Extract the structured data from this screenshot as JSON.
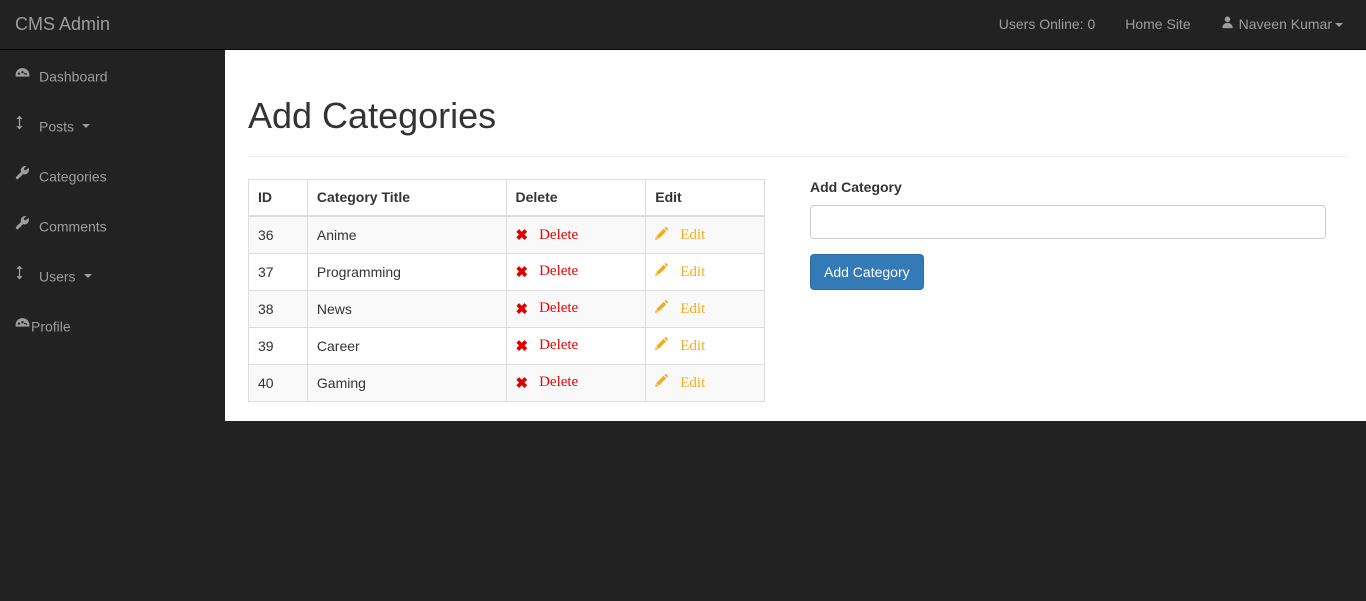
{
  "navbar": {
    "brand": "CMS Admin",
    "users_online": "Users Online: 0",
    "home_site": "Home Site",
    "user_name": "Naveen Kumar",
    "user_icon": "user-icon",
    "brand_color": "#9d9d9d",
    "background": "#222222"
  },
  "sidebar": {
    "items": [
      {
        "label": "Dashboard",
        "icon": "dashboard-icon",
        "caret": false
      },
      {
        "label": "Posts",
        "icon": "arrows-v-icon",
        "caret": true
      },
      {
        "label": "Categories",
        "icon": "wrench-icon",
        "caret": false
      },
      {
        "label": "Comments",
        "icon": "wrench-icon",
        "caret": false
      },
      {
        "label": "Users",
        "icon": "arrows-v-icon",
        "caret": true
      },
      {
        "label": "Profile",
        "icon": "dashboard-icon",
        "caret": false
      }
    ]
  },
  "main": {
    "page_title": "Add Categories",
    "table": {
      "headers": [
        "ID",
        "Category Title",
        "Delete",
        "Edit"
      ],
      "delete_label": "Delete",
      "edit_label": "Edit",
      "delete_icon": "times-icon",
      "edit_icon": "pencil-icon",
      "delete_color": "#ee0000",
      "edit_color": "#f0ad20",
      "rows": [
        {
          "id": "36",
          "title": "Anime"
        },
        {
          "id": "37",
          "title": "Programming"
        },
        {
          "id": "38",
          "title": "News"
        },
        {
          "id": "39",
          "title": "Career"
        },
        {
          "id": "40",
          "title": "Gaming"
        }
      ]
    },
    "form": {
      "label": "Add Category",
      "input_value": "",
      "input_placeholder": "",
      "button_label": "Add Category",
      "button_color": "#337ab7"
    }
  }
}
